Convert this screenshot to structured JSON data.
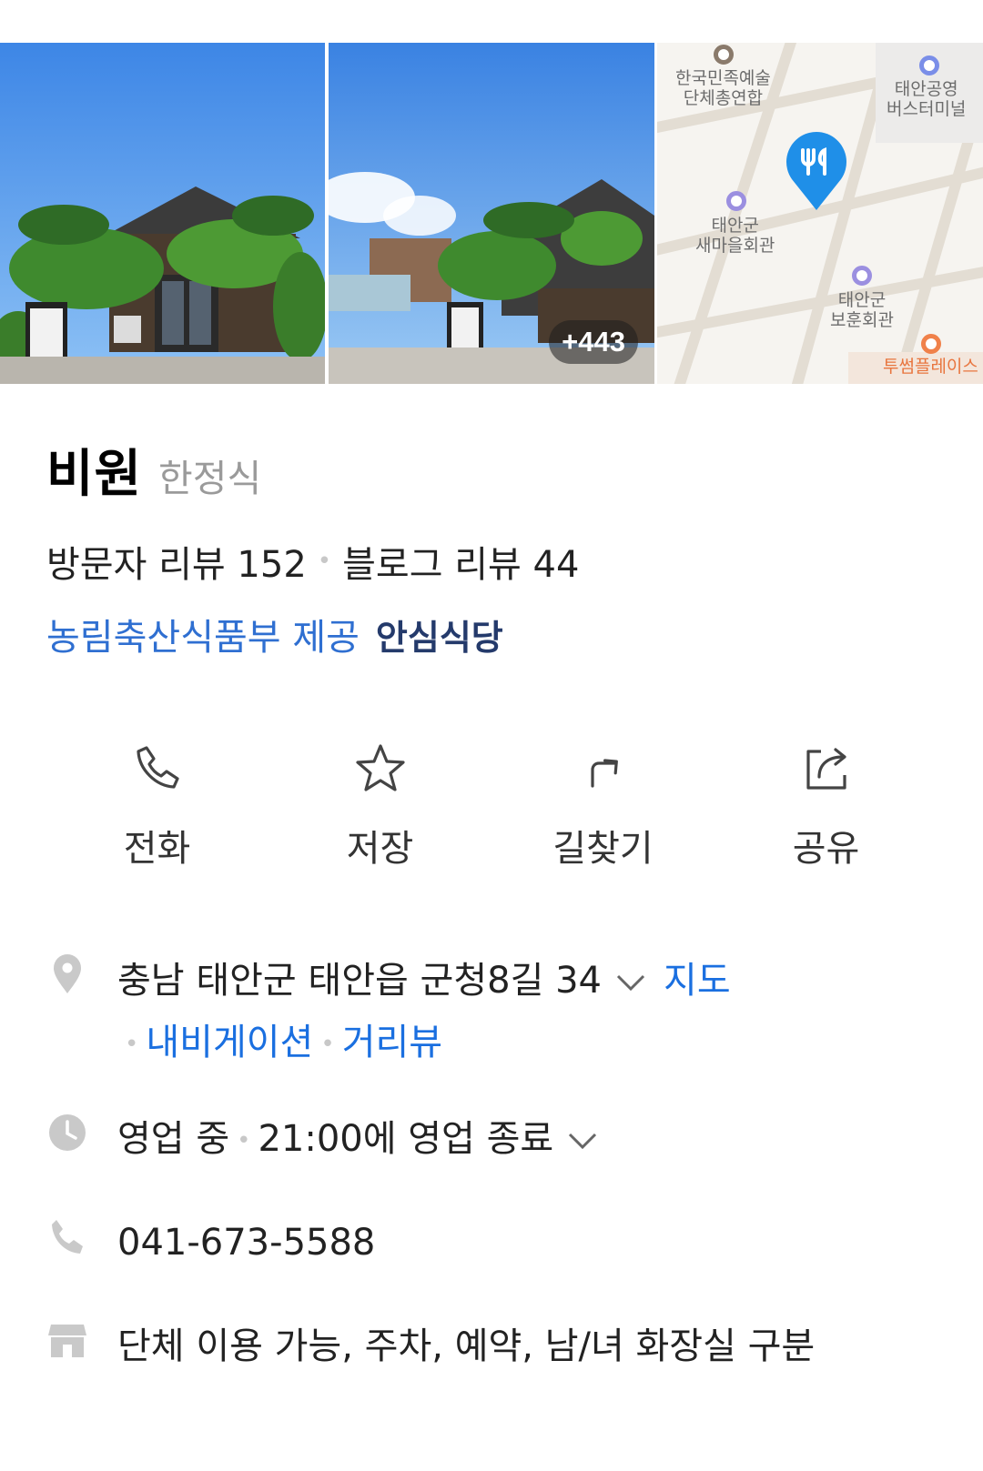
{
  "photos": {
    "more_count": "+443"
  },
  "map": {
    "labels": [
      {
        "text_1": "한국민족예술",
        "text_2": "단체총연합"
      },
      {
        "text_1": "태안공영",
        "text_2": "버스터미널"
      },
      {
        "text_1": "태안군",
        "text_2": "새마을회관"
      },
      {
        "text_1": "태안군",
        "text_2": "보훈회관"
      },
      {
        "text_1": "투썸플레이스"
      }
    ]
  },
  "place": {
    "name": "비원",
    "category": "한정식"
  },
  "reviews": {
    "visitor": "방문자 리뷰 152",
    "blog": "블로그 리뷰 44"
  },
  "provider": {
    "text": "농림축산식품부 제공",
    "badge": "안심식당"
  },
  "actions": [
    {
      "label": "전화",
      "icon": "phone-icon"
    },
    {
      "label": "저장",
      "icon": "star-icon"
    },
    {
      "label": "길찾기",
      "icon": "directions-icon"
    },
    {
      "label": "공유",
      "icon": "share-icon"
    }
  ],
  "info": {
    "address": "충남 태안군 태안읍 군청8길 34",
    "map_link": "지도",
    "navigation_link": "내비게이션",
    "street_view_link": "거리뷰",
    "status": "영업 중",
    "hours": "21:00에 영업 종료",
    "phone": "041-673-5588",
    "facilities": "단체 이용 가능, 주차, 예약, 남/녀 화장실 구분"
  },
  "colors": {
    "link": "#1a6fe0",
    "provider": "#2f6fd1",
    "map_pin": "#1f8fe8"
  }
}
